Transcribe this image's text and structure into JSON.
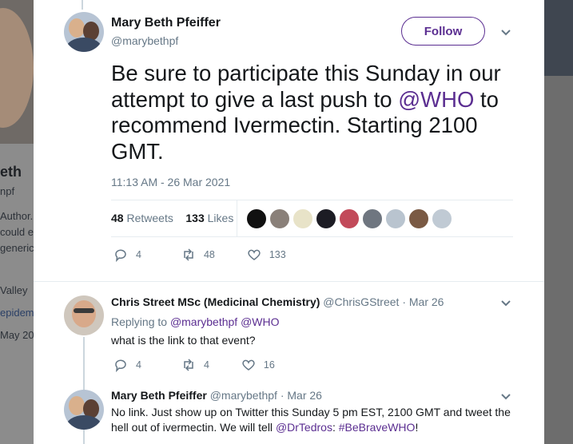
{
  "background": {
    "profile_name": "eth",
    "profile_handle": "npf",
    "bio_lines": [
      "Author.",
      "could e",
      "generic"
    ],
    "location": "Valley",
    "link": "epidem",
    "joined": "May 20"
  },
  "main_tweet": {
    "author_name": "Mary Beth Pfeiffer",
    "author_handle": "@marybethpf",
    "follow_label": "Follow",
    "text_before": "Be sure to participate this Sunday in our attempt to give a last push to ",
    "mention": "@WHO",
    "text_after": " to recommend Ivermectin. Starting 2100 GMT.",
    "timestamp": "11:13 AM - 26 Mar 2021",
    "retweets_count": "48",
    "retweets_label": "Retweets",
    "likes_count": "133",
    "likes_label": "Likes",
    "liker_count": 9,
    "reply_count": "4",
    "retweet_count": "48",
    "like_count": "133"
  },
  "replies": [
    {
      "author_name": "Chris Street MSc (Medicinal Chemistry)",
      "author_handle": "@ChrisGStreet",
      "date": "· Mar 26",
      "replying_prefix": "Replying to",
      "replying_to_1": "@marybethpf",
      "replying_to_2": "@WHO",
      "text": "what is the link to that event?",
      "reply_count": "4",
      "retweet_count": "4",
      "like_count": "16"
    },
    {
      "author_name": "Mary Beth Pfeiffer",
      "author_handle": "@marybethpf",
      "date": "· Mar 26",
      "text_line1": "No link. Just show up on Twitter this Sunday 5 pm EST, 2100 GMT and tweet the",
      "text_line2_before": "hell out of ivermectin. We will tell ",
      "mention": "@DrTedros",
      "text_line2_mid": ": ",
      "hashtag": "#BeBraveWHO",
      "text_line2_end": "!"
    }
  ],
  "colors": {
    "accent": "#5b2e91",
    "text": "#14171a",
    "muted": "#657786",
    "divider": "#e6ecf0"
  }
}
